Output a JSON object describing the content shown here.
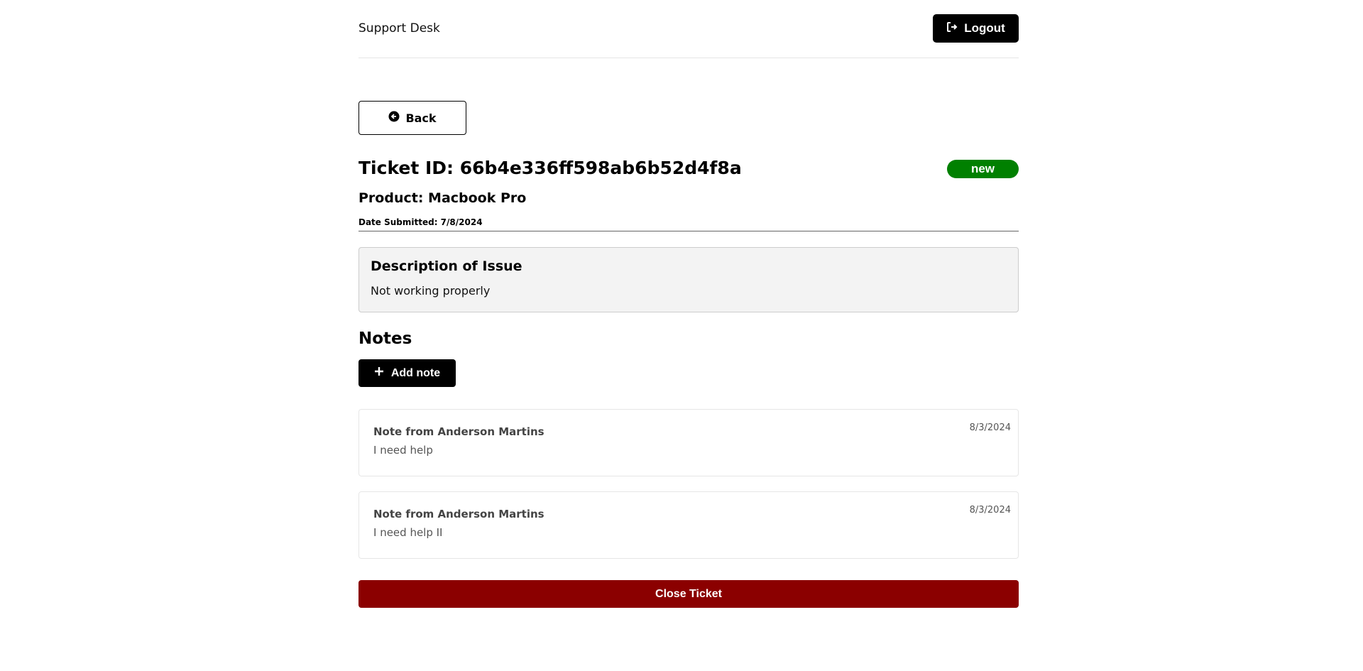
{
  "header": {
    "brand": "Support Desk",
    "logout_label": "Logout"
  },
  "back_label": "Back",
  "ticket": {
    "id_text": "Ticket ID: 66b4e336ff598ab6b52d4f8a",
    "status": "new",
    "status_color": "#008000",
    "product_text": "Product: Macbook Pro",
    "date_text": "Date Submitted: 7/8/2024",
    "description_title": "Description of Issue",
    "description": "Not working properly"
  },
  "notes": {
    "title": "Notes",
    "add_label": "Add note",
    "items": [
      {
        "author": "Note from Anderson Martins",
        "text": "I need help",
        "date": "8/3/2024"
      },
      {
        "author": "Note from Anderson Martins",
        "text": "I need help II",
        "date": "8/3/2024"
      }
    ]
  },
  "close_label": "Close Ticket",
  "close_color": "#8b0000"
}
